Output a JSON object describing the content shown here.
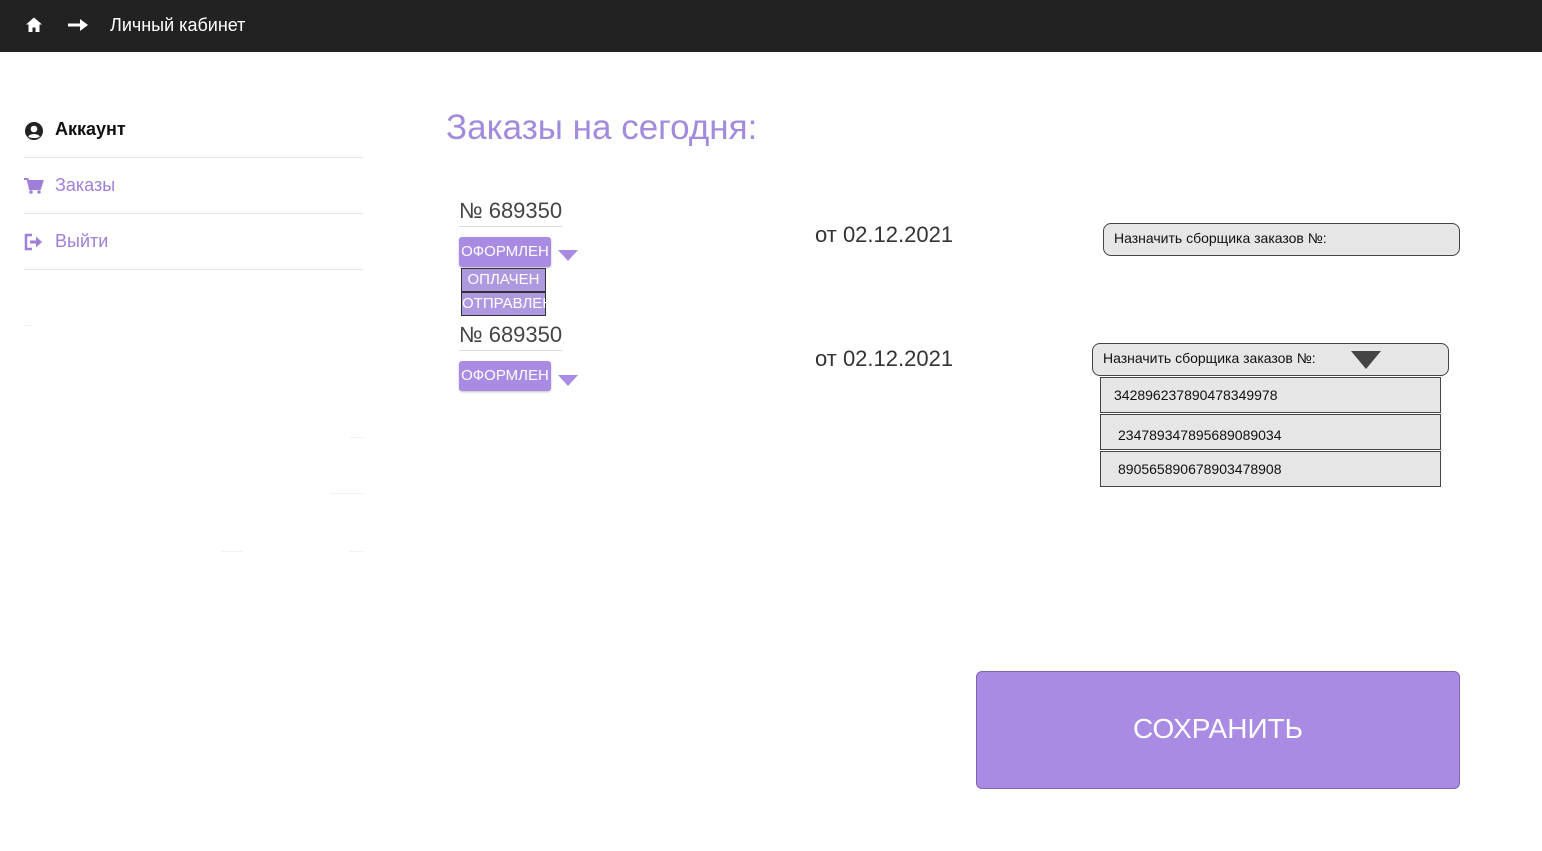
{
  "header": {
    "title": "Личный кабинет",
    "home_icon": "home-icon",
    "nav_icon": "arrow-right-icon"
  },
  "sidebar": {
    "items": [
      {
        "label": "Аккаунт",
        "icon": "user-circle-icon",
        "active": true
      },
      {
        "label": "Заказы",
        "icon": "cart-icon",
        "active": false
      },
      {
        "label": "Выйти",
        "icon": "sign-out-icon",
        "active": false
      }
    ]
  },
  "main": {
    "title": "Заказы на сегодня:",
    "orders": [
      {
        "number": "№ 689350",
        "status": "ОФОРМЛЕН",
        "status_options": [
          "ОПЛАЧЕН",
          "ОТПРАВЛЕН"
        ],
        "date": "от 02.12.2021",
        "assign_label": "Назначить сборщика заказов №:"
      },
      {
        "number": "№ 689350",
        "status": "ОФОРМЛЕН",
        "date": "от 02.12.2021",
        "assign_label": "Назначить сборщика заказов №:",
        "assembler_options": [
          "342896237890478349978",
          "234789347895689089034",
          "890565890678903478908"
        ]
      }
    ],
    "save_label": "СОХРАНИТЬ"
  },
  "colors": {
    "accent": "#a98be4",
    "title": "#a28bdc",
    "header_bg": "#222222",
    "muted_link": "#a07fd8"
  }
}
